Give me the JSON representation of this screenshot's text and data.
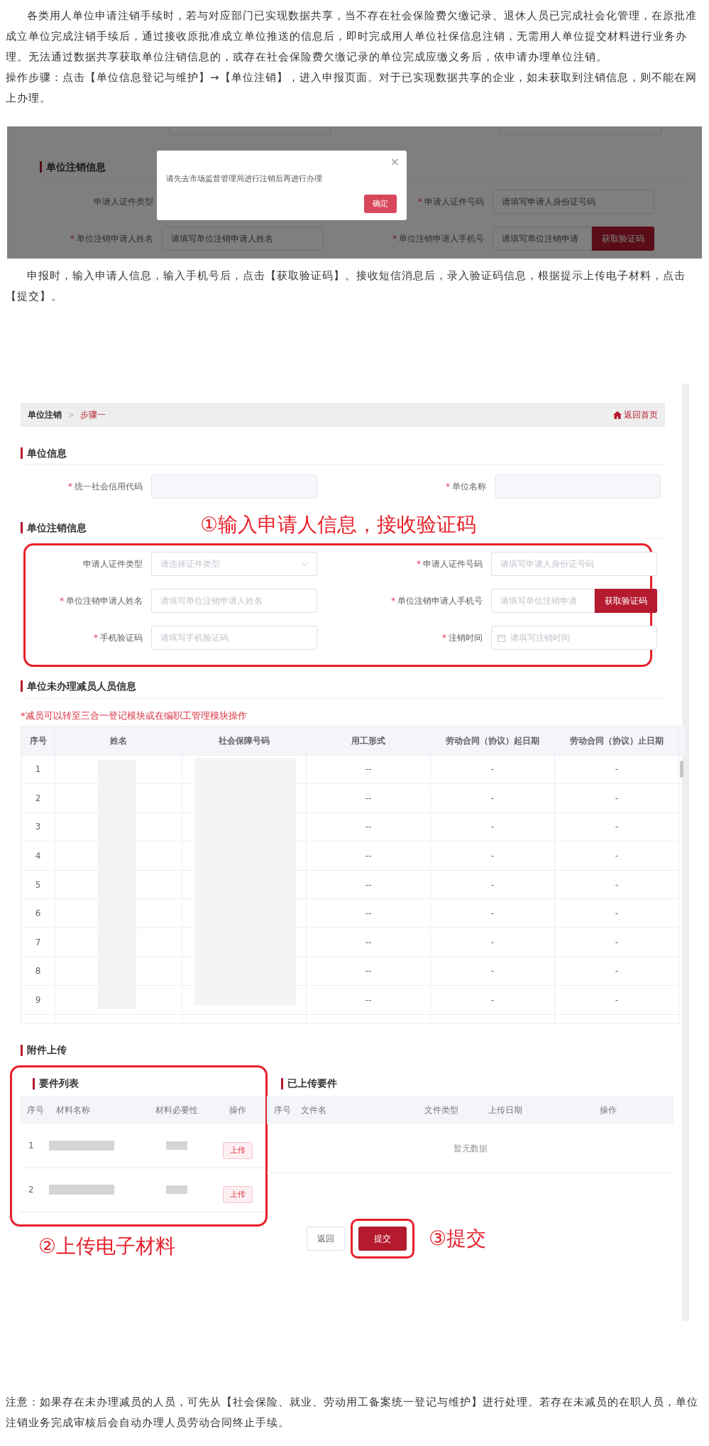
{
  "intro": "各类用人单位申请注销手续时，若与对应部门已实现数据共享，当不存在社会保险费欠缴记录、退休人员已完成社会化管理，在原批准成立单位完成注销手续后，通过接收原批准成立单位推送的信息后，即时完成用人单位社保信息注销，无需用人单位提交材料进行业务办理。无法通过数据共享获取单位注销信息的，或存在社会保险费欠缴记录的单位完成应缴义务后，依申请办理单位注销。",
  "steps": "操作步骤：点击【单位信息登记与维护】→【单位注销】，进入申报页面。对于已实现数据共享的企业，如未获取到注销信息，则不能在网上办理。",
  "screenshot_1": {
    "section_title": "单位注销信息",
    "fields": [
      {
        "label": "申请人证件类型",
        "kind": "text"
      },
      {
        "star": "*",
        "label": "申请人证件号码",
        "kind": "text",
        "placeholder": "请填写申请人身份证号码"
      },
      {
        "star": "*",
        "label": "单位注销申请人姓名",
        "kind": "text",
        "placeholder": "请填写单位注销申请人姓名"
      },
      {
        "star": "*",
        "label": "单位注销申请人手机号",
        "kind": "sms",
        "placeholder": "请填写单位注销申请",
        "button": "获取验证码"
      }
    ],
    "dialog": {
      "message": "请先去市场监督管理局进行注销后再进行办理",
      "close": "×",
      "ok": "确定"
    }
  },
  "instruction": "申报时，输入申请人信息，输入手机号后，点击【获取验证码】。接收短信消息后，录入验证码信息，根据提示上传电子材料，点击【提交】。",
  "screenshot_2": {
    "breadcrumb": [
      {
        "label": "单位注销",
        "selected": false
      },
      {
        "label": "步骤一",
        "selected": true
      }
    ],
    "separator": ">",
    "home_link": "返回首页",
    "unit_info": {
      "title": "单位信息",
      "fields": [
        {
          "star": "*",
          "label": "统一社会信用代码",
          "kind": "readonly"
        },
        {
          "star": "*",
          "label": "单位名称",
          "kind": "readonly"
        }
      ]
    },
    "cancel_info": {
      "title": "单位注销信息",
      "annotation": "①输入申请人信息，接收验证码",
      "fields": [
        {
          "label": "申请人证件类型",
          "kind": "select",
          "placeholder": "请选择证件类型"
        },
        {
          "star": "*",
          "label": "申请人证件号码",
          "kind": "text",
          "placeholder": "请填写申请人身份证号码"
        },
        {
          "star": "*",
          "label": "单位注销申请人姓名",
          "kind": "text",
          "placeholder": "请填写单位注销申请人姓名"
        },
        {
          "star": "*",
          "label": "单位注销申请人手机号",
          "kind": "sms",
          "placeholder": "请填写单位注销申请",
          "button": "获取验证码"
        },
        {
          "star": "*",
          "label": "手机验证码",
          "kind": "text",
          "placeholder": "请填写手机验证码"
        },
        {
          "star": "*",
          "label": "注销时间",
          "kind": "date",
          "placeholder": "请填写注销时间"
        }
      ]
    },
    "staff": {
      "title": "单位未办理减员人员信息",
      "note": "*减员可以转至三合一登记模块或在编职工管理模块操作",
      "columns": [
        "序号",
        "姓名",
        "社会保障号码",
        "用工形式",
        "劳动合同（协议）起日期",
        "劳动合同（协议）止日期"
      ],
      "rows": [
        {
          "no": "1",
          "employment": "--",
          "start": "-",
          "end": "-"
        },
        {
          "no": "2",
          "employment": "--",
          "start": "-",
          "end": "-"
        },
        {
          "no": "3",
          "employment": "--",
          "start": "-",
          "end": "-"
        },
        {
          "no": "4",
          "employment": "--",
          "start": "-",
          "end": "-"
        },
        {
          "no": "5",
          "employment": "--",
          "start": "-",
          "end": "-"
        },
        {
          "no": "6",
          "employment": "--",
          "start": "-",
          "end": "-"
        },
        {
          "no": "7",
          "employment": "--",
          "start": "-",
          "end": "-"
        },
        {
          "no": "8",
          "employment": "--",
          "start": "-",
          "end": "-"
        },
        {
          "no": "9",
          "employment": "--",
          "start": "-",
          "end": "-"
        }
      ]
    },
    "attachments": {
      "title": "附件上传",
      "annotation": "②上传电子材料",
      "required_list": {
        "title": "要件列表",
        "columns": [
          "序号",
          "材料名称",
          "材料必要性",
          "操作"
        ],
        "rows": [
          {
            "no": "1",
            "action": "上传"
          },
          {
            "no": "2",
            "action": "上传"
          }
        ]
      },
      "uploaded": {
        "title": "已上传要件",
        "columns": [
          "序号",
          "文件名",
          "文件类型",
          "上传日期",
          "操作"
        ],
        "empty": "暂无数据"
      }
    },
    "buttons": [
      {
        "label": "返回",
        "kind": "default"
      },
      {
        "label": "提交",
        "kind": "primary"
      }
    ],
    "submit_annotation": "③提交"
  },
  "note": "注意：如果存在未办理减员的人员，可先从【社会保险、就业、劳动用工备案统一登记与维护】进行处理。若存在未减员的在职人员，单位注销业务完成审核后会自动办理人员劳动合同终止手续。"
}
